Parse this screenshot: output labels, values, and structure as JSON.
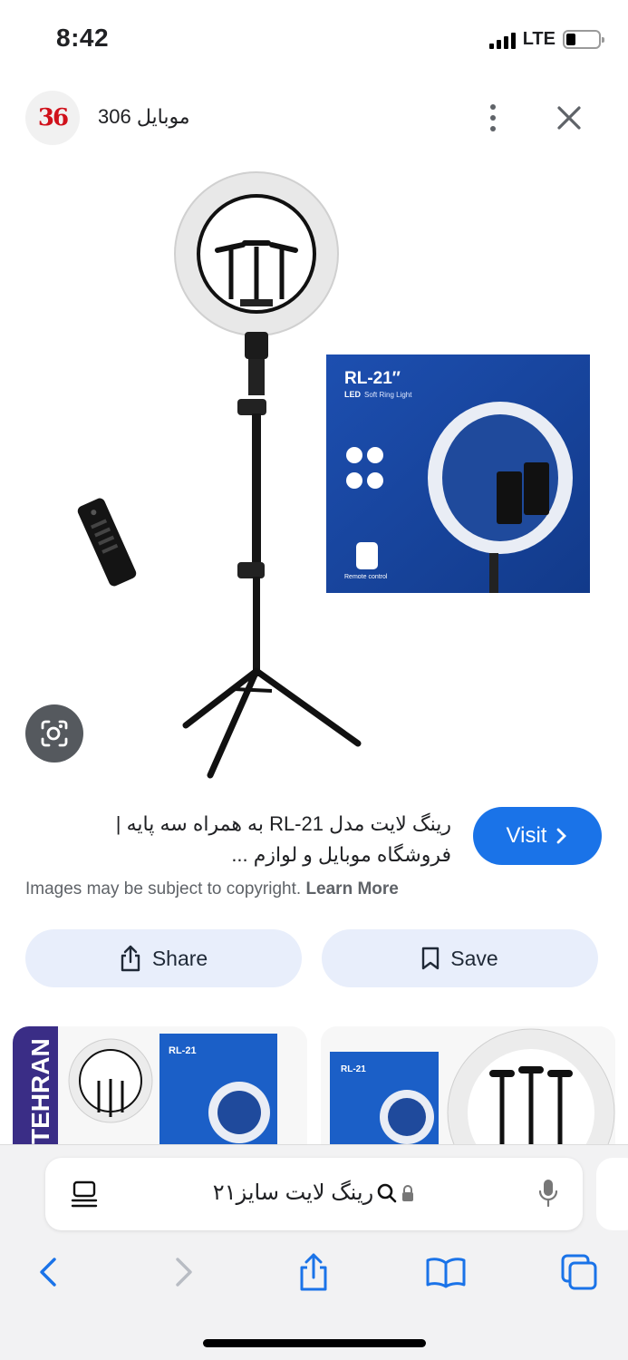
{
  "status_bar": {
    "time": "8:42",
    "network": "LTE",
    "battery_level": 0.3
  },
  "source": {
    "logo_text": "36",
    "name": "موبایل 306",
    "more_icon": "more-vert-icon",
    "close_icon": "close-icon"
  },
  "main_image": {
    "box_brand": "RL-21″",
    "box_subtitle": "Soft Ring Light",
    "box_led": "LED",
    "box_remote": "Remote control"
  },
  "result": {
    "title_line1": "رینگ لایت مدل RL-21 به همراه سه پایه |",
    "title_line2": "فروشگاه موبایل و لوازم ...",
    "visit_label": "Visit",
    "copyright_text": "Images may be subject to copyright.",
    "learn_more": "Learn More",
    "share_label": "Share",
    "save_label": "Save"
  },
  "related": {
    "thumb1_brand": "TEHRAN",
    "thumb1_box": "RL-21",
    "thumb2_box": "RL-21"
  },
  "browser": {
    "address_query": "رینگ لایت سایز۲۱",
    "toolbar": [
      "back-icon",
      "forward-icon",
      "share-icon",
      "bookmarks-icon",
      "tabs-icon"
    ]
  },
  "colors": {
    "accent": "#1a73e8",
    "chip_bg": "#e8eefb",
    "logo_red": "#d0111b",
    "box_blue": "#1b4aa8"
  }
}
